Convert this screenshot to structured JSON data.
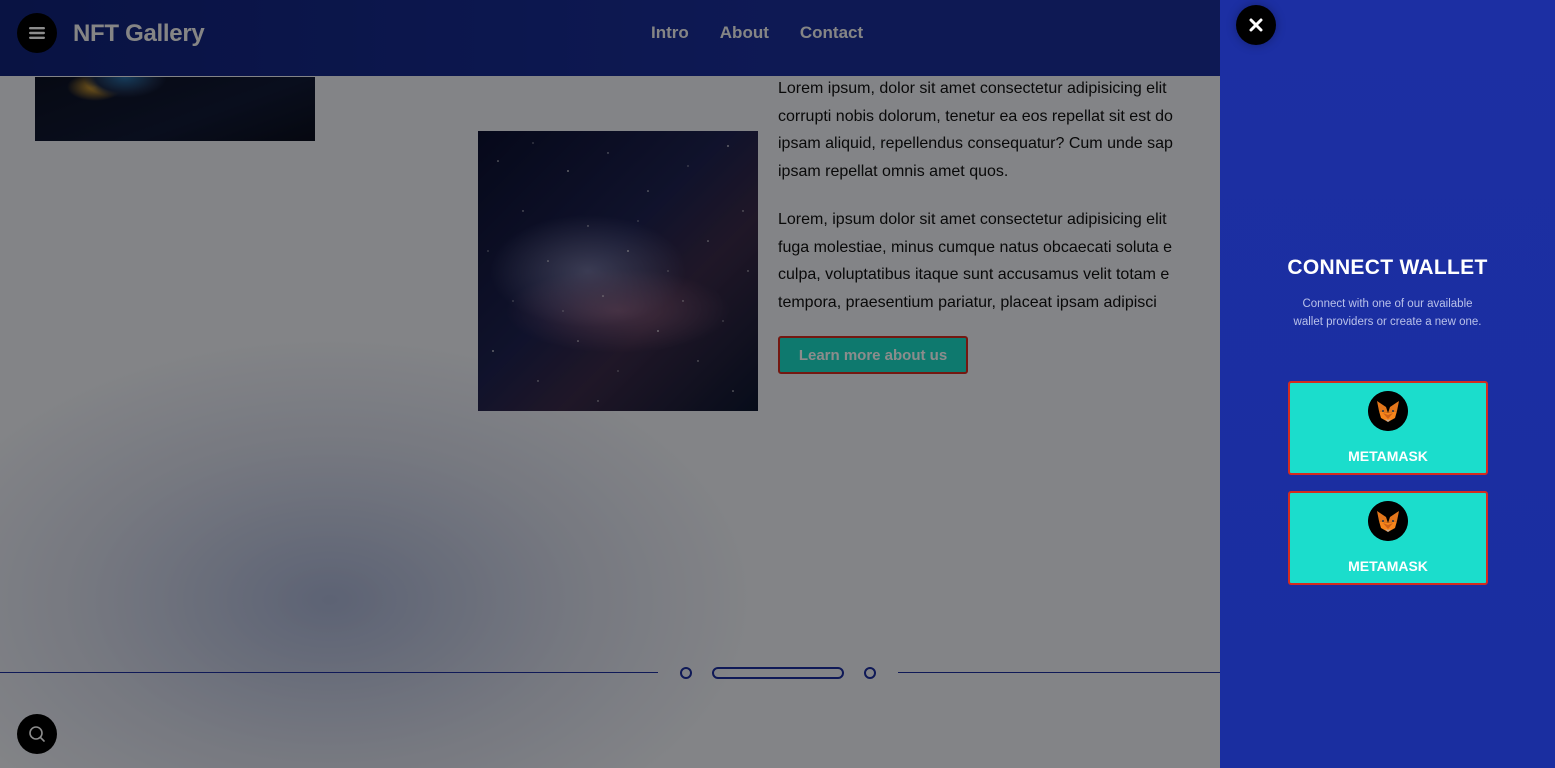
{
  "header": {
    "brand": "NFT Gallery",
    "nav": [
      "Intro",
      "About",
      "Contact"
    ]
  },
  "about": {
    "paragraphs": [
      [
        "Lorem ipsum, dolor sit amet consectetur adipisicing elit",
        "corrupti nobis dolorum, tenetur ea eos repellat sit est do",
        "ipsam aliquid, repellendus consequatur? Cum unde sap",
        "ipsam repellat omnis amet quos."
      ],
      [
        "Lorem, ipsum dolor sit amet consectetur adipisicing elit",
        "fuga molestiae, minus cumque natus obcaecati soluta e",
        "culpa, voluptatibus itaque sunt accusamus velit totam e",
        "tempora, praesentium pariatur, placeat ipsam adipisci"
      ]
    ],
    "button_label": "Learn more about us"
  },
  "wallet_panel": {
    "title": "CONNECT WALLET",
    "subtitle": "Connect with one of our available wallet providers or create a new one.",
    "providers": [
      {
        "label": "METAMASK",
        "icon": "metamask-fox-icon"
      },
      {
        "label": "METAMASK",
        "icon": "metamask-fox-icon"
      }
    ]
  },
  "icons": {
    "menu": "hamburger-menu-icon",
    "search": "search-icon",
    "close": "close-icon"
  },
  "colors": {
    "header_bg": "#1a2e9a",
    "panel_bg": "#1c2fa3",
    "accent_teal": "#1bddcc",
    "accent_border": "#d42c1f"
  }
}
